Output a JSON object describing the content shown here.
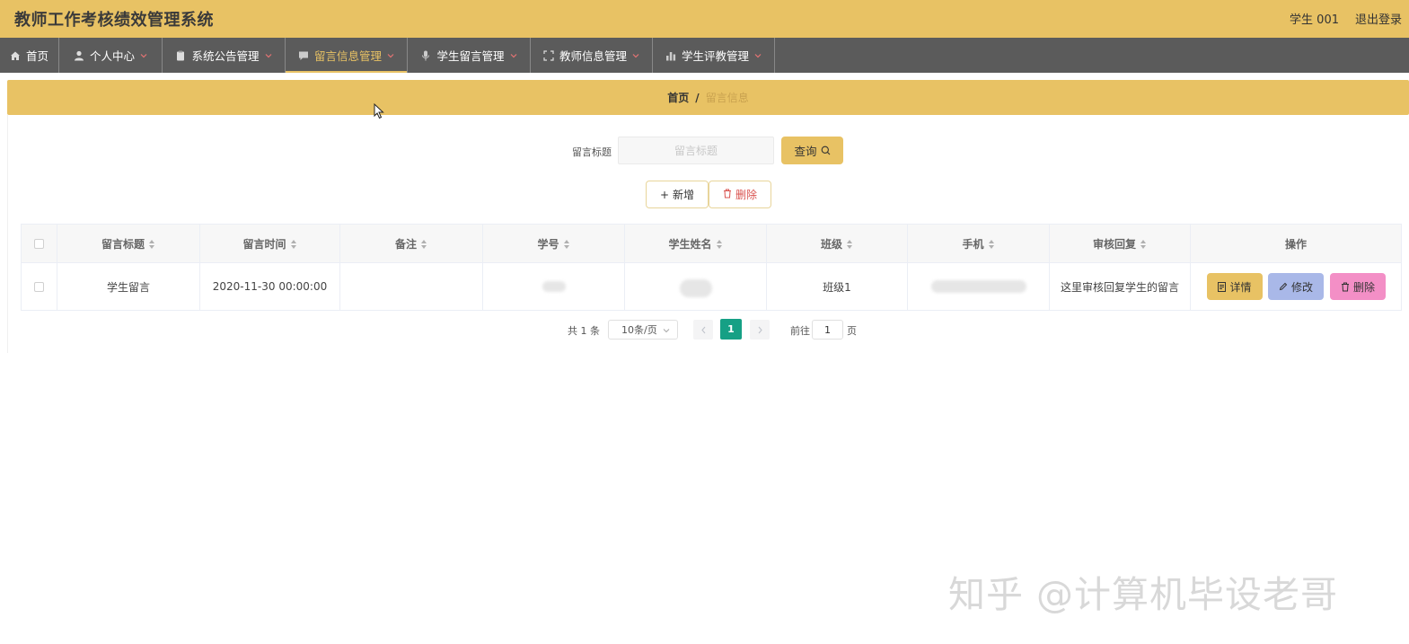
{
  "header": {
    "title": "教师工作考核绩效管理系统",
    "user": "学生 001",
    "logout": "退出登录"
  },
  "nav": {
    "items": [
      {
        "label": "首页",
        "icon": "home-icon"
      },
      {
        "label": "个人中心",
        "icon": "user-icon"
      },
      {
        "label": "系统公告管理",
        "icon": "clipboard-icon"
      },
      {
        "label": "留言信息管理",
        "icon": "message-icon",
        "active": true
      },
      {
        "label": "学生留言管理",
        "icon": "mic-icon"
      },
      {
        "label": "教师信息管理",
        "icon": "fullscreen-icon"
      },
      {
        "label": "学生评教管理",
        "icon": "bar-chart-icon"
      }
    ]
  },
  "breadcrumb": {
    "home": "首页",
    "separator": "/",
    "current": "留言信息"
  },
  "search": {
    "label": "留言标题",
    "placeholder": "留言标题",
    "value": "",
    "query_label": "查询"
  },
  "actions": {
    "add_label": "新增",
    "delete_label": "删除"
  },
  "table": {
    "columns": [
      "留言标题",
      "留言时间",
      "备注",
      "学号",
      "学生姓名",
      "班级",
      "手机",
      "审核回复",
      "操作"
    ],
    "rows": [
      {
        "title": "学生留言",
        "time": "2020-11-30 00:00:00",
        "remark": "",
        "student_no": "",
        "student_name": "",
        "class": "班级1",
        "phone": "",
        "reply": "这里审核回复学生的留言"
      }
    ],
    "row_actions": {
      "detail": "详情",
      "edit": "修改",
      "delete": "删除"
    }
  },
  "pagination": {
    "total": "共 1 条",
    "page_size": "10条/页",
    "current_page": "1",
    "goto_label": "前往",
    "goto_value": "1",
    "page_suffix": "页"
  },
  "watermark": "知乎 @计算机毕设老哥",
  "colors": {
    "accent": "#e8c264",
    "nav_bg": "#5b5b5b",
    "page_active": "#16a085",
    "edit_btn": "#a9b8e8",
    "delete_btn": "#f38fc6"
  }
}
